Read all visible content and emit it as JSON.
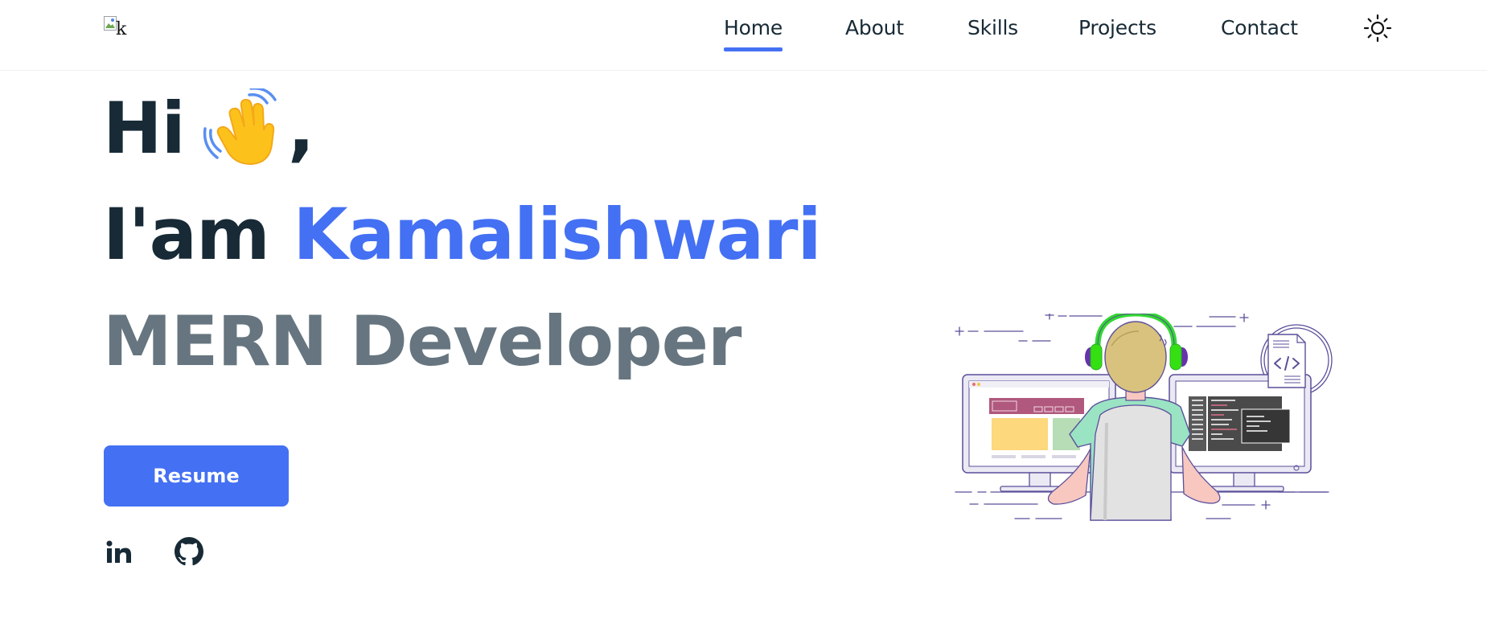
{
  "nav": {
    "logo_alt": "k",
    "links": [
      {
        "label": "Home"
      },
      {
        "label": "About"
      },
      {
        "label": "Skills"
      },
      {
        "label": "Projects"
      },
      {
        "label": "Contact"
      }
    ],
    "theme_icon": "sun-icon"
  },
  "hero": {
    "greeting": "Hi",
    "wave_icon": "waving-hand-emoji",
    "comma": ",",
    "intro": "I'am",
    "name": "Kamalishwari",
    "role": "MERN Developer",
    "resume_label": "Resume",
    "social_icons": [
      "linkedin-icon",
      "github-icon"
    ]
  },
  "colors": {
    "accent": "#4470f3",
    "heading": "#172a36",
    "muted": "#66757f"
  }
}
